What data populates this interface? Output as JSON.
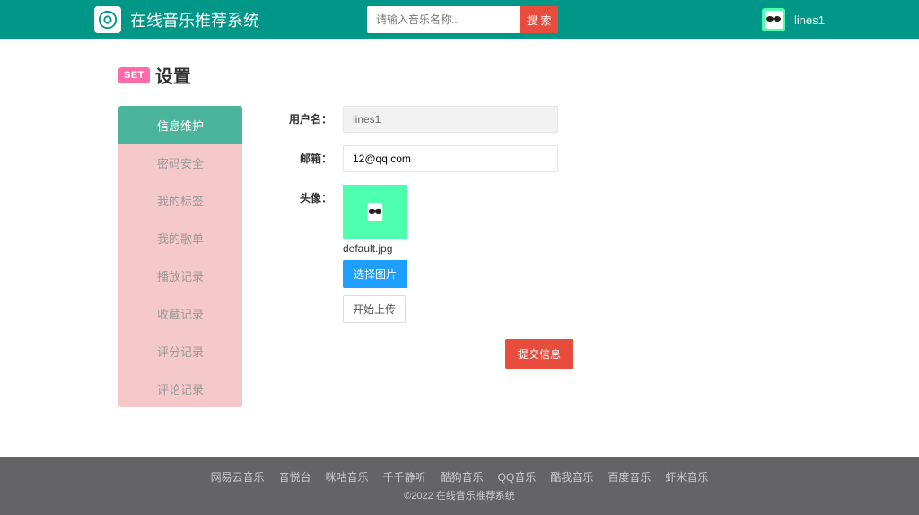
{
  "header": {
    "app_title": "在线音乐推荐系统",
    "search_placeholder": "请输入音乐名称...",
    "search_button": "搜 索",
    "username": "lines1"
  },
  "page": {
    "badge": "SET",
    "title": "设置"
  },
  "sidebar": {
    "items": [
      "信息维护",
      "密码安全",
      "我的标签",
      "我的歌单",
      "播放记录",
      "收藏记录",
      "评分记录",
      "评论记录"
    ]
  },
  "form": {
    "username_label": "用户名：",
    "username_value": "lines1",
    "email_label": "邮箱：",
    "email_value": "12@qq.com",
    "avatar_label": "头像：",
    "avatar_filename": "default.jpg",
    "choose_button": "选择图片",
    "upload_button": "开始上传",
    "submit_button": "提交信息"
  },
  "footer": {
    "links": [
      "网易云音乐",
      "音悦台",
      "咪咕音乐",
      "千千静听",
      "酷狗音乐",
      "QQ音乐",
      "酷我音乐",
      "百度音乐",
      "虾米音乐"
    ],
    "copyright": "©2022 在线音乐推荐系统"
  }
}
